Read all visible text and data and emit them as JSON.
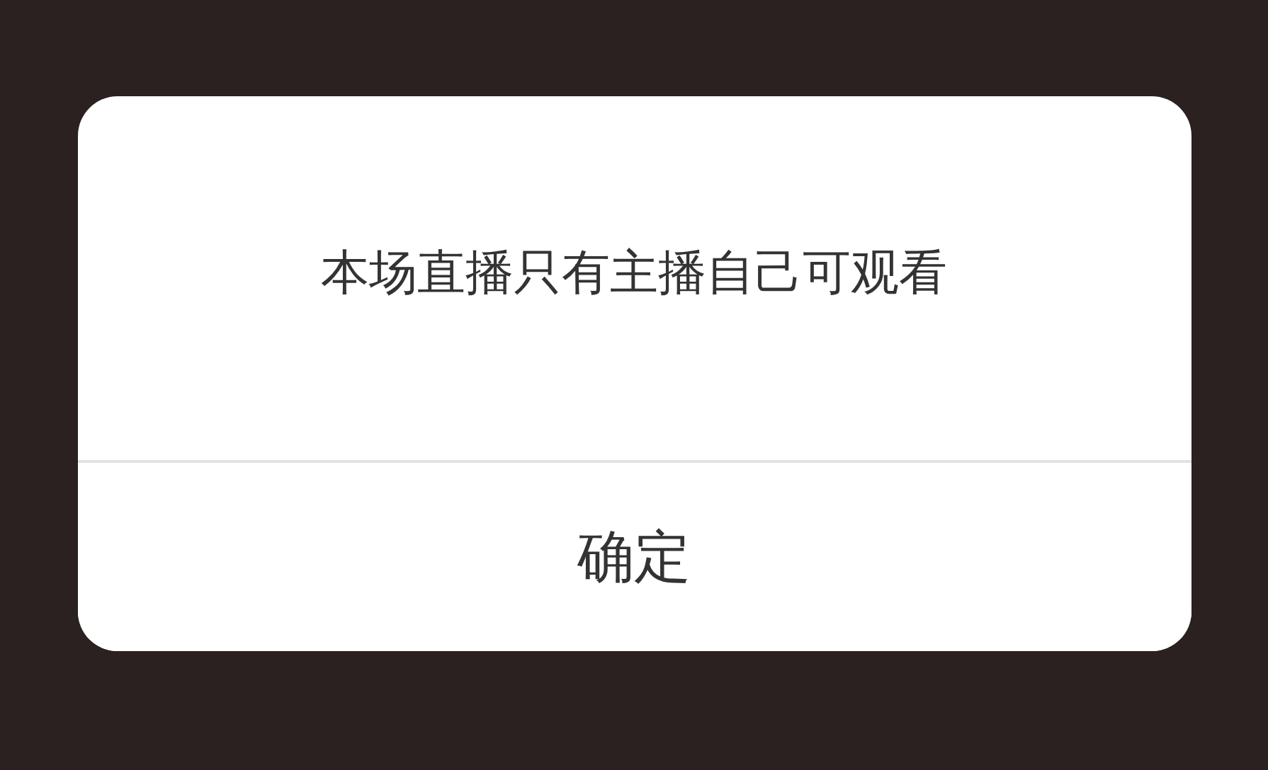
{
  "dialog": {
    "message": "本场直播只有主播自己可观看",
    "buttons": [
      "确定"
    ]
  }
}
